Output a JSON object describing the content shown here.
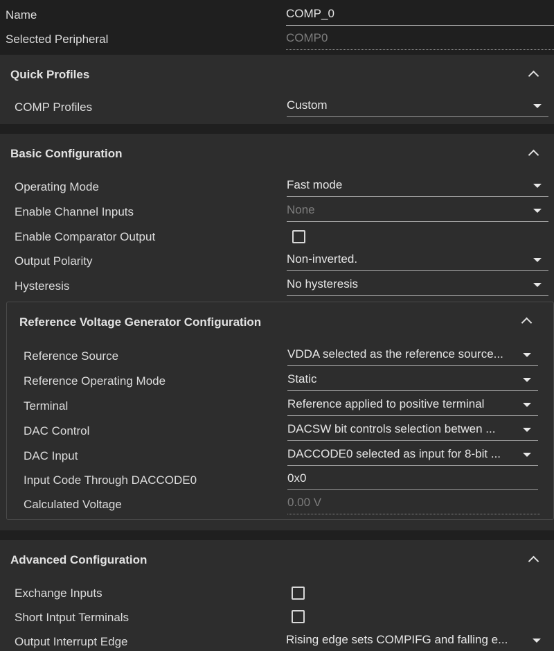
{
  "header": {
    "name_label": "Name",
    "name_value": "COMP_0",
    "peripheral_label": "Selected Peripheral",
    "peripheral_value": "COMP0"
  },
  "quick_profiles": {
    "title": "Quick Profiles",
    "comp_profiles_label": "COMP Profiles",
    "comp_profiles_value": "Custom"
  },
  "basic": {
    "title": "Basic Configuration",
    "operating_mode_label": "Operating Mode",
    "operating_mode_value": "Fast mode",
    "channel_inputs_label": "Enable Channel Inputs",
    "channel_inputs_value": "None",
    "comparator_output_label": "Enable Comparator Output",
    "comparator_output_checked": false,
    "output_polarity_label": "Output Polarity",
    "output_polarity_value": "Non-inverted.",
    "hysteresis_label": "Hysteresis",
    "hysteresis_value": "No hysteresis"
  },
  "ref_voltage": {
    "title": "Reference Voltage Generator Configuration",
    "ref_source_label": "Reference Source",
    "ref_source_value": "VDDA selected as the reference source...",
    "ref_mode_label": "Reference Operating Mode",
    "ref_mode_value": "Static",
    "terminal_label": "Terminal",
    "terminal_value": "Reference applied to positive terminal",
    "dac_control_label": "DAC Control",
    "dac_control_value": "DACSW bit controls selection betwen ...",
    "dac_input_label": "DAC Input",
    "dac_input_value": "DACCODE0 selected as input for 8-bit ...",
    "input_code_label": "Input Code Through DACCODE0",
    "input_code_value": "0x0",
    "calc_voltage_label": "Calculated Voltage",
    "calc_voltage_value": "0.00 V"
  },
  "advanced": {
    "title": "Advanced Configuration",
    "exchange_inputs_label": "Exchange Inputs",
    "exchange_inputs_checked": false,
    "short_terminals_label": "Short Intput Terminals",
    "short_terminals_checked": false,
    "interrupt_edge_label": "Output Interrupt Edge",
    "interrupt_edge_value": "Rising edge sets COMPIFG and falling e..."
  },
  "icons": {
    "dropdown": "caret-down-icon",
    "collapse": "chevron-up-icon",
    "checkbox": "checkbox-icon"
  },
  "colors": {
    "background": "#1f1f1f",
    "panel": "#2d2d2d",
    "text": "#dedede",
    "disabled_text": "#7d7d7d"
  }
}
